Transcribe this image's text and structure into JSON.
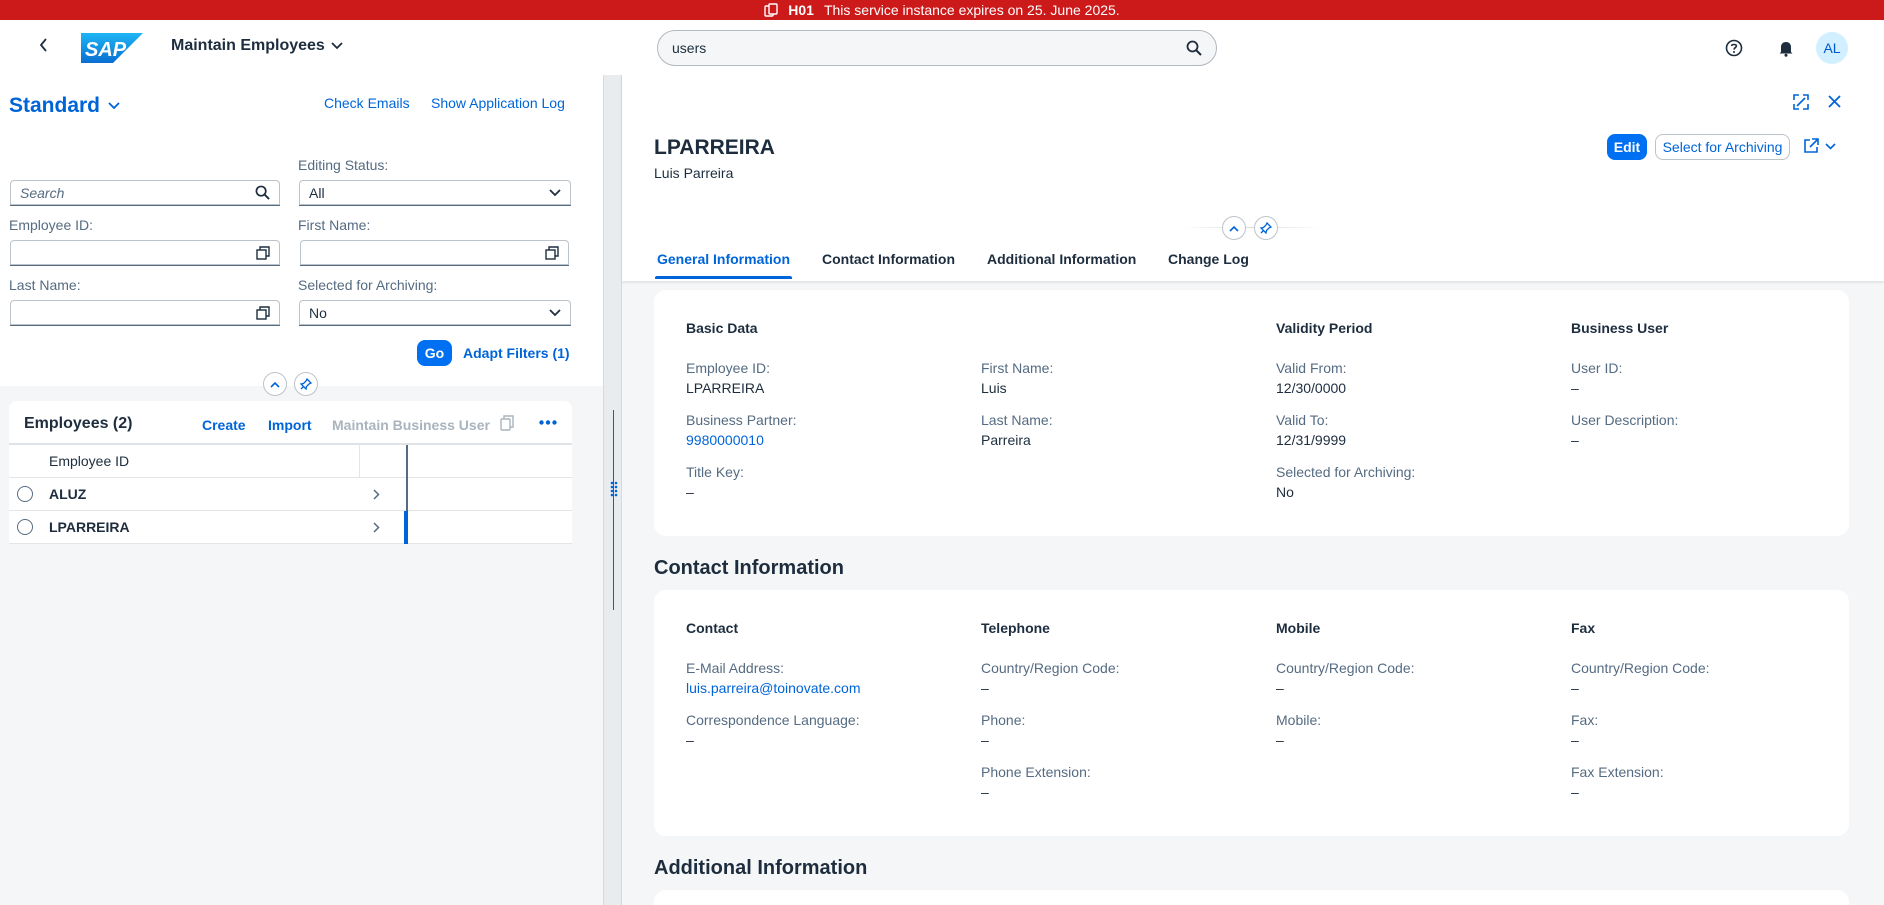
{
  "banner": {
    "system": "H01",
    "message": "This service instance expires on 25. June 2025."
  },
  "shell": {
    "logo_text": "SAP",
    "app_title": "Maintain Employees",
    "search_value": "users",
    "avatar_initials": "AL"
  },
  "filterbar": {
    "variant": "Standard",
    "check_emails": "Check Emails",
    "show_app_log": "Show Application Log",
    "search_placeholder": "Search",
    "editing_status_label": "Editing Status:",
    "editing_status_value": "All",
    "employee_id_label": "Employee ID:",
    "first_name_label": "First Name:",
    "last_name_label": "Last Name:",
    "archiving_label": "Selected for Archiving:",
    "archiving_value": "No",
    "go": "Go",
    "adapt_filters": "Adapt Filters (1)"
  },
  "table": {
    "title": "Employees (2)",
    "create": "Create",
    "import": "Import",
    "maintain_business_user": "Maintain Business User",
    "column_employee_id": "Employee ID",
    "rows": [
      {
        "id": "ALUZ"
      },
      {
        "id": "LPARREIRA"
      }
    ]
  },
  "object": {
    "title": "LPARREIRA",
    "subtitle": "Luis Parreira",
    "edit": "Edit",
    "select_archiving": "Select for Archiving",
    "tabs": [
      "General Information",
      "Contact Information",
      "Additional Information",
      "Change Log"
    ]
  },
  "general": {
    "basic_data": "Basic Data",
    "validity_period": "Validity Period",
    "business_user": "Business User",
    "employee_id_label": "Employee ID:",
    "employee_id_value": "LPARREIRA",
    "first_name_label": "First Name:",
    "first_name_value": "Luis",
    "valid_from_label": "Valid From:",
    "valid_from_value": "12/30/0000",
    "user_id_label": "User ID:",
    "user_id_value": "–",
    "business_partner_label": "Business Partner:",
    "business_partner_value": "9980000010",
    "last_name_label": "Last Name:",
    "last_name_value": "Parreira",
    "valid_to_label": "Valid To:",
    "valid_to_value": "12/31/9999",
    "user_desc_label": "User Description:",
    "user_desc_value": "–",
    "title_key_label": "Title Key:",
    "title_key_value": "–",
    "archiving_label": "Selected for Archiving:",
    "archiving_value": "No"
  },
  "contact": {
    "heading": "Contact Information",
    "contact": "Contact",
    "telephone": "Telephone",
    "mobile": "Mobile",
    "fax": "Fax",
    "email_label": "E-Mail Address:",
    "email_value": "luis.parreira@toinovate.com",
    "lang_label": "Correspondence Language:",
    "lang_value": "–",
    "tel_country_label": "Country/Region Code:",
    "tel_country_value": "–",
    "phone_label": "Phone:",
    "phone_value": "–",
    "phone_ext_label": "Phone Extension:",
    "phone_ext_value": "–",
    "mob_country_label": "Country/Region Code:",
    "mob_country_value": "–",
    "mobile_label": "Mobile:",
    "mobile_value": "–",
    "fax_country_label": "Country/Region Code:",
    "fax_country_value": "–",
    "fax_label": "Fax:",
    "fax_value": "–",
    "fax_ext_label": "Fax Extension:",
    "fax_ext_value": "–"
  },
  "additional": {
    "heading": "Additional Information"
  },
  "colors": {
    "banner": "#cc1919",
    "brand": "#0070f2",
    "link": "#0064d9"
  }
}
